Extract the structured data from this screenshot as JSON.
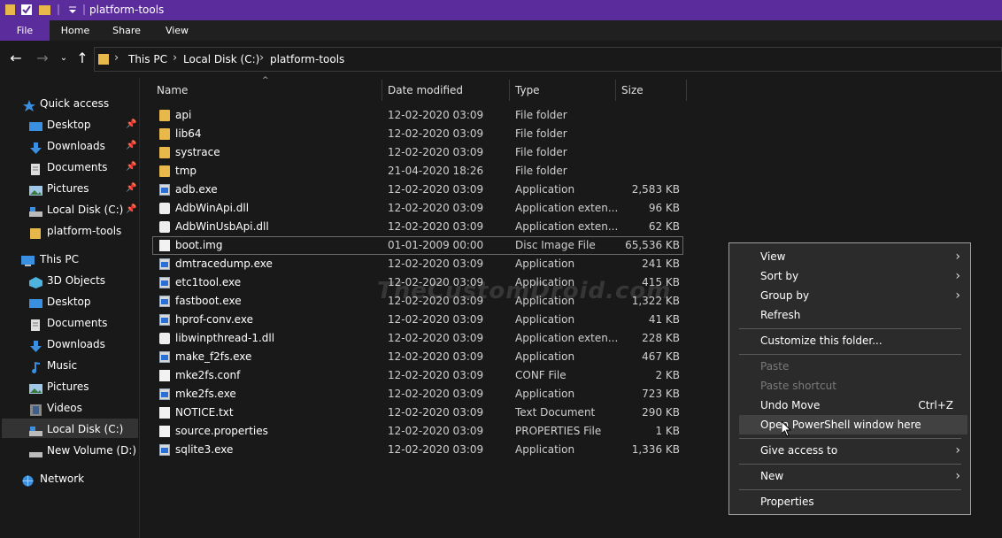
{
  "window": {
    "title": "platform-tools"
  },
  "ribbon": {
    "tabs": [
      "File",
      "Home",
      "Share",
      "View"
    ]
  },
  "address": {
    "crumbs": [
      "This PC",
      "Local Disk (C:)",
      "platform-tools"
    ]
  },
  "sidebar": {
    "quick_access": "Quick access",
    "quick_items": [
      "Desktop",
      "Downloads",
      "Documents",
      "Pictures",
      "Local Disk (C:)",
      "platform-tools"
    ],
    "this_pc": "This PC",
    "pc_items": [
      "3D Objects",
      "Desktop",
      "Documents",
      "Downloads",
      "Music",
      "Pictures",
      "Videos",
      "Local Disk (C:)",
      "New Volume (D:)"
    ],
    "network": "Network"
  },
  "columns": {
    "name": "Name",
    "date": "Date modified",
    "type": "Type",
    "size": "Size"
  },
  "files": [
    {
      "name": "api",
      "date": "12-02-2020 03:09",
      "type": "File folder",
      "size": ""
    },
    {
      "name": "lib64",
      "date": "12-02-2020 03:09",
      "type": "File folder",
      "size": ""
    },
    {
      "name": "systrace",
      "date": "12-02-2020 03:09",
      "type": "File folder",
      "size": ""
    },
    {
      "name": "tmp",
      "date": "21-04-2020 18:26",
      "type": "File folder",
      "size": ""
    },
    {
      "name": "adb.exe",
      "date": "12-02-2020 03:09",
      "type": "Application",
      "size": "2,583 KB"
    },
    {
      "name": "AdbWinApi.dll",
      "date": "12-02-2020 03:09",
      "type": "Application exten...",
      "size": "96 KB"
    },
    {
      "name": "AdbWinUsbApi.dll",
      "date": "12-02-2020 03:09",
      "type": "Application exten...",
      "size": "62 KB"
    },
    {
      "name": "boot.img",
      "date": "01-01-2009 00:00",
      "type": "Disc Image File",
      "size": "65,536 KB"
    },
    {
      "name": "dmtracedump.exe",
      "date": "12-02-2020 03:09",
      "type": "Application",
      "size": "241 KB"
    },
    {
      "name": "etc1tool.exe",
      "date": "12-02-2020 03:09",
      "type": "Application",
      "size": "415 KB"
    },
    {
      "name": "fastboot.exe",
      "date": "12-02-2020 03:09",
      "type": "Application",
      "size": "1,322 KB"
    },
    {
      "name": "hprof-conv.exe",
      "date": "12-02-2020 03:09",
      "type": "Application",
      "size": "41 KB"
    },
    {
      "name": "libwinpthread-1.dll",
      "date": "12-02-2020 03:09",
      "type": "Application exten...",
      "size": "228 KB"
    },
    {
      "name": "make_f2fs.exe",
      "date": "12-02-2020 03:09",
      "type": "Application",
      "size": "467 KB"
    },
    {
      "name": "mke2fs.conf",
      "date": "12-02-2020 03:09",
      "type": "CONF File",
      "size": "2 KB"
    },
    {
      "name": "mke2fs.exe",
      "date": "12-02-2020 03:09",
      "type": "Application",
      "size": "723 KB"
    },
    {
      "name": "NOTICE.txt",
      "date": "12-02-2020 03:09",
      "type": "Text Document",
      "size": "290 KB"
    },
    {
      "name": "source.properties",
      "date": "12-02-2020 03:09",
      "type": "PROPERTIES File",
      "size": "1 KB"
    },
    {
      "name": "sqlite3.exe",
      "date": "12-02-2020 03:09",
      "type": "Application",
      "size": "1,336 KB"
    }
  ],
  "watermark": "TheCustomDroid.com",
  "context_menu": {
    "view": "View",
    "sort_by": "Sort by",
    "group_by": "Group by",
    "refresh": "Refresh",
    "customize": "Customize this folder...",
    "paste": "Paste",
    "paste_shortcut": "Paste shortcut",
    "undo_move": "Undo Move",
    "undo_shortcut": "Ctrl+Z",
    "open_powershell": "Open PowerShell window here",
    "give_access": "Give access to",
    "new": "New",
    "properties": "Properties"
  },
  "colors": {
    "accent": "#5b2c9b",
    "background": "#191919",
    "folder": "#e8b84a"
  }
}
